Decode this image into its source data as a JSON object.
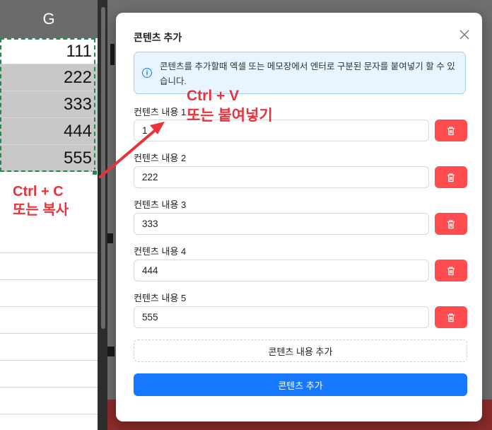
{
  "spreadsheet": {
    "column_header": "G",
    "selected_cells": [
      "111",
      "222",
      "333",
      "444",
      "555"
    ]
  },
  "annotations": {
    "copy_line1": "Ctrl + C",
    "copy_line2": "또는 복사",
    "paste_line1": "Ctrl + V",
    "paste_line2": "또는 붙여넣기",
    "accent_color": "#e8333d"
  },
  "modal": {
    "title": "콘텐츠 추가",
    "info_text": "콘텐츠를 추가할때 엑셀 또는 메모장에서 엔터로 구분된 문자를 붙여넣기 할 수 있습니다.",
    "fields": [
      {
        "label": "컨텐츠 내용 1",
        "value": "1"
      },
      {
        "label": "컨텐츠 내용 2",
        "value": "222"
      },
      {
        "label": "컨텐츠 내용 3",
        "value": "333"
      },
      {
        "label": "컨텐츠 내용 4",
        "value": "444"
      },
      {
        "label": "컨텐츠 내용 5",
        "value": "555"
      }
    ],
    "add_field_label": "콘텐츠 내용 추가",
    "submit_label": "콘텐츠 추가",
    "primary_color": "#1677ff",
    "danger_color": "#ff4d4f",
    "delete_icon": "trash-icon",
    "close_icon": "close-icon",
    "info_icon": "info-icon"
  }
}
